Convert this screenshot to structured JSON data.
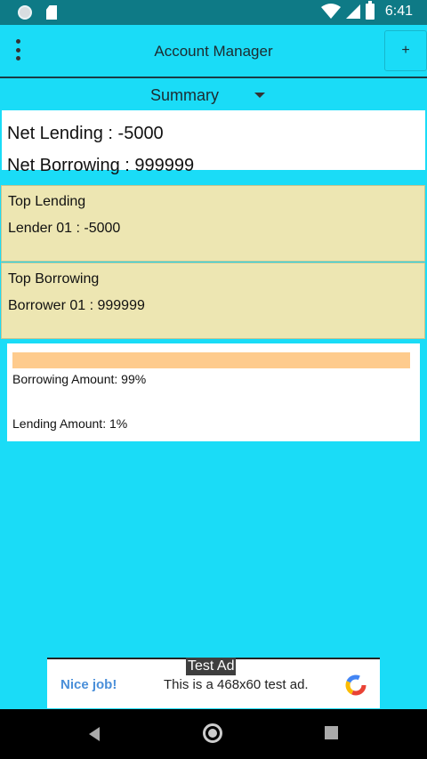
{
  "status_bar": {
    "time": "6:41",
    "icons": [
      "circle-notification-icon",
      "sd-card-icon",
      "wifi-icon",
      "signal-icon",
      "battery-icon"
    ]
  },
  "toolbar": {
    "title": "Account Manager",
    "add_label": "+",
    "menu_icon": "overflow-menu-icon"
  },
  "view_selector": {
    "selected": "Summary"
  },
  "net": {
    "lending": "Net Lending : -5000",
    "borrowing": "Net Borrowing : 999999"
  },
  "top_lending": {
    "heading": "Top Lending",
    "entry": "Lender 01 : -5000"
  },
  "top_borrowing": {
    "heading": "Top Borrowing",
    "entry": "Borrower 01 : 999999"
  },
  "ratio_chart": {
    "borrowing_label": "Borrowing Amount: 99%",
    "lending_label": "Lending Amount: 1%",
    "borrowing_percent": 99,
    "lending_percent": 1,
    "bar_color": "#fecb8d"
  },
  "ad": {
    "tag": "Test Ad",
    "cta": "Nice job!",
    "text": "This is a 468x60 test ad."
  },
  "colors": {
    "background": "#1adcf7",
    "status_bar": "#0e7a86",
    "card_highlight": "#ede6b2"
  }
}
